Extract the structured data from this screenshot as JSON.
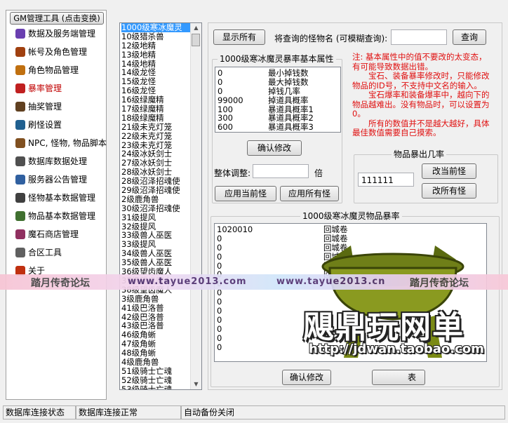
{
  "nav": {
    "header": "GM管理工具 (点击变换)",
    "items": [
      {
        "label": "数据及服务端管理",
        "icon": "gear-book-icon",
        "color": "#6a3fb0"
      },
      {
        "label": "帐号及角色管理",
        "icon": "person-icon",
        "color": "#a04010"
      },
      {
        "label": "角色物品管理",
        "icon": "bag-icon",
        "color": "#c07010"
      },
      {
        "label": "暴率管理",
        "icon": "drop-rate-icon",
        "color": "#c02020",
        "selected": true
      },
      {
        "label": "抽奖管理",
        "icon": "lottery-icon",
        "color": "#604020"
      },
      {
        "label": "刷怪设置",
        "icon": "monster-icon",
        "color": "#206090"
      },
      {
        "label": "NPC, 怪物, 物品脚本",
        "icon": "script-icon",
        "color": "#805020"
      },
      {
        "label": "数据库数据处理",
        "icon": "database-icon",
        "color": "#505050"
      },
      {
        "label": "服务器公告管理",
        "icon": "announcement-icon",
        "color": "#3060a0"
      },
      {
        "label": "怪物基本数据管理",
        "icon": "monster-data-icon",
        "color": "#404040"
      },
      {
        "label": "物品基本数据管理",
        "icon": "item-data-icon",
        "color": "#407030"
      },
      {
        "label": "魔石商店管理",
        "icon": "shop-icon",
        "color": "#903060"
      },
      {
        "label": "合区工具",
        "icon": "merge-icon",
        "color": "#606060"
      },
      {
        "label": "关于",
        "icon": "about-icon",
        "color": "#c03010"
      }
    ]
  },
  "monsters": [
    "1000级寒冰魔灵",
    "10级猎杀兽",
    "12级地精",
    "13级地精",
    "14级地精",
    "14级龙怪",
    "15级龙怪",
    "16级龙怪",
    "16级绿魔精",
    "17级绿魔精",
    "18级绿魔精",
    "21级未克灯笼",
    "22级未克灯笼",
    "23级未克灯笼",
    "24级冰妖剑士",
    "27级冰妖剑士",
    "28级冰妖剑士",
    "28级沼泽招魂使",
    "29级沼泽招魂使",
    "2级鹿角兽",
    "30级沼泽招魂使",
    "31级提风",
    "32级提风",
    "33级兽人巫医",
    "33级提风",
    "34级兽人巫医",
    "35级兽人巫医",
    "36级望齿魔人",
    "37级望齿魔人",
    "38级望齿魔人",
    "3级鹿角兽",
    "41级巴洛普",
    "42级巴洛普",
    "43级巴洛普",
    "46级角蜥",
    "47级角蜥",
    "48级角蜥",
    "4级鹿角兽",
    "51级骑士亡魂",
    "52级骑士亡魂",
    "53级骑士亡魂"
  ],
  "toolbar": {
    "show_all": "显示所有",
    "query_label": "将查询的怪物名 (可模糊查询):",
    "query_value": "",
    "query_button": "查询"
  },
  "attrs": {
    "title": "1000级寒冰魔灵暴率基本属性",
    "rows": [
      {
        "value": "0",
        "name": "最小掉钱数"
      },
      {
        "value": "0",
        "name": "最大掉钱数"
      },
      {
        "value": "0",
        "name": "掉钱几率"
      },
      {
        "value": "99000",
        "name": "掉道具概率"
      },
      {
        "value": "100",
        "name": "暴道具概率1"
      },
      {
        "value": "300",
        "name": "暴道具概率2"
      },
      {
        "value": "600",
        "name": "暴道具概率3"
      }
    ],
    "confirm": "确认修改",
    "adjust_label": "整体调整:",
    "adjust_value": "",
    "times": "倍",
    "apply_current": "应用当前怪",
    "apply_all": "应用所有怪"
  },
  "note": {
    "p1": "注: 基本属性中的值不要改的太变态，有可能导致数据出错。",
    "p2": "宝石、装备暴率修改时，只能修改物品的ID号，不支持中文名的输入。",
    "p3": "宝石爆率和装备爆率中，越向下的物品越难出。没有物品时，可以设置为0。",
    "p4": "所有的数值并不是越大越好，具体最佳数值需要自己摸索。"
  },
  "drop_count": {
    "title": "物品暴出几率",
    "value": "111111",
    "change_current": "改当前怪",
    "change_all": "改所有怪"
  },
  "items": {
    "title": "1000级寒冰魔灵物品暴率",
    "rows": [
      {
        "id": "1020010",
        "name": "回城卷"
      },
      {
        "id": "0",
        "name": "回城卷"
      },
      {
        "id": "0",
        "name": "回城卷"
      },
      {
        "id": "0",
        "name": "回城卷"
      },
      {
        "id": "0",
        "name": "回"
      },
      {
        "id": "0",
        "name": "回"
      },
      {
        "id": "0",
        "name": ""
      },
      {
        "id": "0",
        "name": ""
      },
      {
        "id": "0",
        "name": ""
      },
      {
        "id": "0",
        "name": ""
      },
      {
        "id": "0",
        "name": ""
      },
      {
        "id": "0",
        "name": ""
      },
      {
        "id": "0",
        "name": ""
      },
      {
        "id": "0",
        "name": ""
      }
    ],
    "confirm": "确认修改",
    "hidden_button": "表"
  },
  "watermark": {
    "left": "踏月传奇论坛",
    "url1": "www.tayue2013.com",
    "url2": "www.tayue2013.cn",
    "right": "踏月传奇论坛",
    "logo_text": "飓鼎玩网单",
    "logo_url": "http://jdwan.taobao.com"
  },
  "status": {
    "db_label": "数据库连接状态",
    "db_value": "数据库连接正常",
    "backup": "自动备份关闭"
  }
}
